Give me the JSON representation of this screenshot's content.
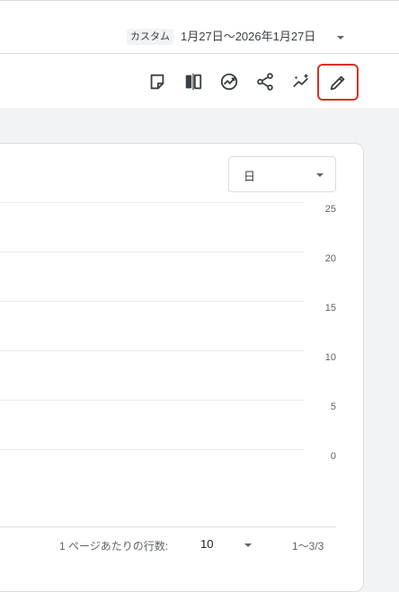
{
  "header": {
    "date_chip": "カスタム",
    "date_range": "1月27日〜2026年1月27日"
  },
  "toolbar": {
    "icons": [
      "sticky-note-icon",
      "compare-icon",
      "insights-icon",
      "share-icon",
      "sparkle-trend-icon",
      "edit-pencil-icon"
    ],
    "highlight_color": "#d93025"
  },
  "chart": {
    "granularity_select": "日",
    "y_ticks": [
      "25",
      "20",
      "15",
      "10",
      "5",
      "0"
    ]
  },
  "pagination": {
    "rows_per_page_label": "1 ページあたりの行数:",
    "rows_per_page_value": "10",
    "range_label": "1〜3/3"
  }
}
